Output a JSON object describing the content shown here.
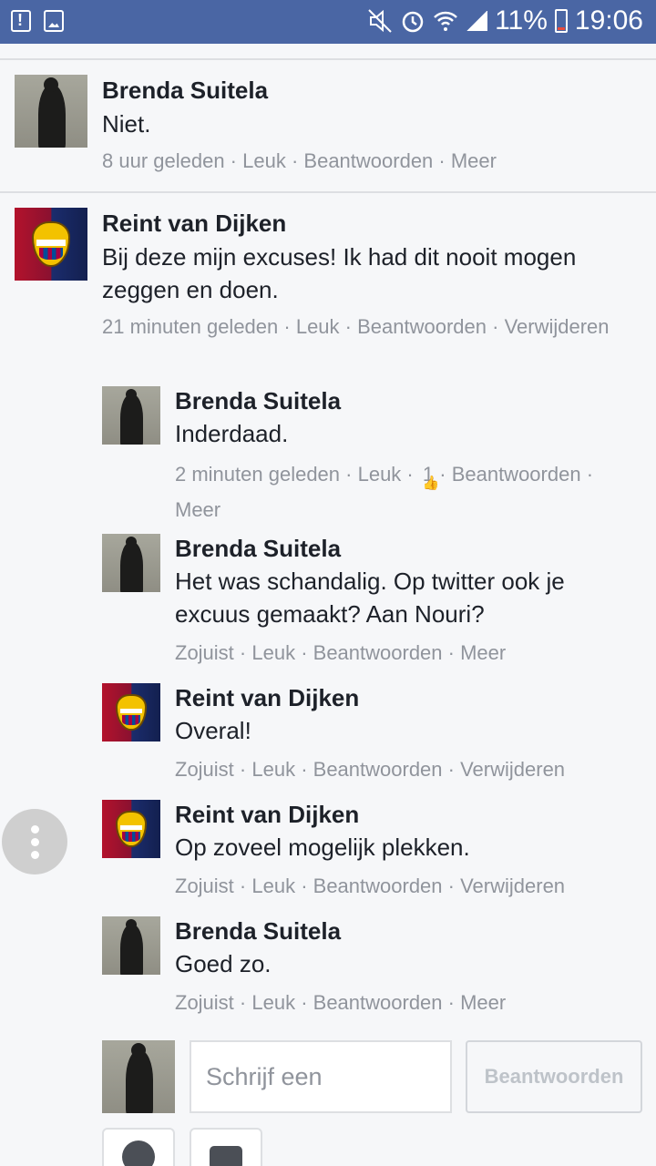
{
  "status_bar": {
    "battery": "11%",
    "time": "19:06"
  },
  "meta_sep": " · ",
  "comments": [
    {
      "name": "Brenda Suitela",
      "text": "Niet.",
      "time": "8 uur geleden",
      "like": "Leuk",
      "reply": "Beantwoorden",
      "more": "Meer"
    },
    {
      "name": "Reint van Dijken",
      "text": "Bij deze mijn excuses! Ik had dit nooit mogen zeggen en doen.",
      "time": "21 minuten geleden",
      "like": "Leuk",
      "reply": "Beantwoorden",
      "more": "Verwijderen"
    }
  ],
  "replies": [
    {
      "name": "Brenda Suitela",
      "text": "Inderdaad.",
      "time": "2 minuten geleden",
      "like": "Leuk",
      "like_count": "1",
      "reply": "Beantwoorden",
      "more": "Meer"
    },
    {
      "name": "Brenda Suitela",
      "text": "Het was schandalig. Op twitter ook je excuus gemaakt? Aan Nouri?",
      "time": "Zojuist",
      "like": "Leuk",
      "reply": "Beantwoorden",
      "more": "Meer"
    },
    {
      "name": "Reint van Dijken",
      "text": "Overal!",
      "time": "Zojuist",
      "like": "Leuk",
      "reply": "Beantwoorden",
      "more": "Verwijderen"
    },
    {
      "name": "Reint van Dijken",
      "text": "Op zoveel mogelijk plekken.",
      "time": "Zojuist",
      "like": "Leuk",
      "reply": "Beantwoorden",
      "more": "Verwijderen"
    },
    {
      "name": "Brenda Suitela",
      "text": "Goed zo.",
      "time": "Zojuist",
      "like": "Leuk",
      "reply": "Beantwoorden",
      "more": "Meer"
    }
  ],
  "composer": {
    "placeholder": "Schrijf een",
    "reply_button": "Beantwoorden"
  },
  "icons": [
    "alert-icon",
    "gallery-icon",
    "mute-icon",
    "alarm-icon",
    "wifi-icon",
    "signal-icon",
    "battery-icon",
    "more-vert-icon",
    "like-icon",
    "smiley-icon",
    "camera-icon"
  ]
}
